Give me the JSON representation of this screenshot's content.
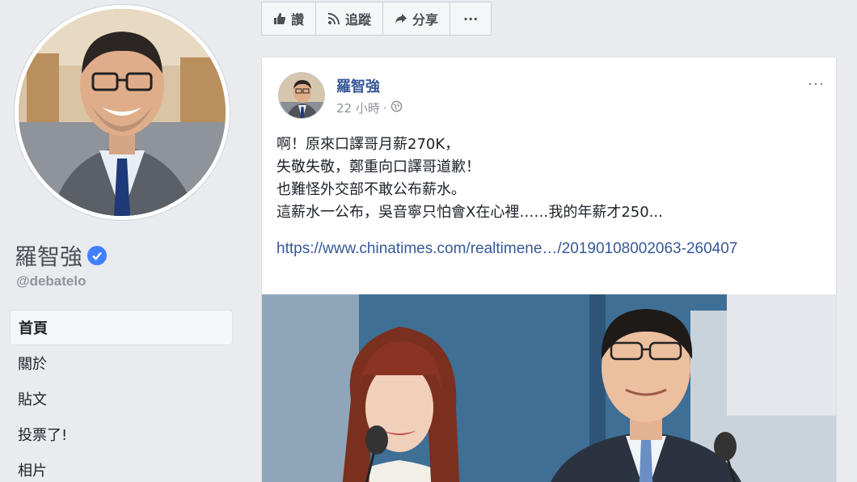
{
  "sidebar": {
    "page_name": "羅智強",
    "handle": "@debatelo",
    "nav": [
      {
        "label": "首頁",
        "active": true
      },
      {
        "label": "關於",
        "active": false
      },
      {
        "label": "貼文",
        "active": false
      },
      {
        "label": "投票了!",
        "active": false
      },
      {
        "label": "相片",
        "active": false
      }
    ]
  },
  "actions": {
    "like": "讚",
    "follow": "追蹤",
    "share": "分享",
    "more": "···"
  },
  "post": {
    "author": "羅智強",
    "time": "22 小時",
    "separator": "·",
    "more": "···",
    "lines": [
      "啊！原來口譯哥月薪270K，",
      "失敬失敬，鄭重向口譯哥道歉！",
      "也難怪外交部不敢公布薪水。",
      "這薪水一公布，吳音寧只怕會X在心裡……我的年薪才250..."
    ],
    "link": "https://www.chinatimes.com/realtimene…/20190108002063-260407"
  },
  "colors": {
    "background": "#e9ebee",
    "link": "#365899",
    "author": "#385898",
    "verified": "#4080ff"
  }
}
